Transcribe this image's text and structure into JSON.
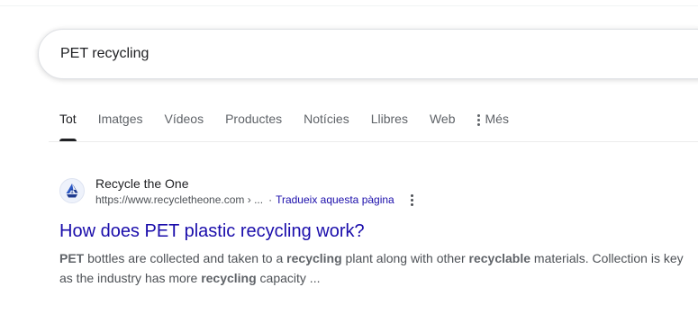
{
  "search": {
    "query": "PET recycling"
  },
  "tabs": [
    {
      "label": "Tot",
      "active": true
    },
    {
      "label": "Imatges"
    },
    {
      "label": "Vídeos"
    },
    {
      "label": "Productes"
    },
    {
      "label": "Notícies"
    },
    {
      "label": "Llibres"
    },
    {
      "label": "Web"
    },
    {
      "label": "Més",
      "icon": "more-vert-icon"
    }
  ],
  "result": {
    "favicon_icon": "recycle-icon",
    "site_name": "Recycle the One",
    "url": "https://www.recycletheone.com › ...",
    "separator": "·",
    "translate_label": "Tradueix aquesta pàgina",
    "title": "How does PET plastic recycling work?",
    "snippet_parts": [
      {
        "text": "PET",
        "bold": true
      },
      {
        "text": " bottles are collected and taken to a ",
        "bold": false
      },
      {
        "text": "recycling",
        "bold": true
      },
      {
        "text": " plant along with other ",
        "bold": false
      },
      {
        "text": "recyclable",
        "bold": true
      },
      {
        "text": " materials. Collection is key as the industry has more ",
        "bold": false
      },
      {
        "text": "recycling",
        "bold": true
      },
      {
        "text": " capacity ...",
        "bold": false
      }
    ]
  },
  "colors": {
    "link": "#1a0dab",
    "text": "#202124",
    "secondary": "#5f6368"
  }
}
